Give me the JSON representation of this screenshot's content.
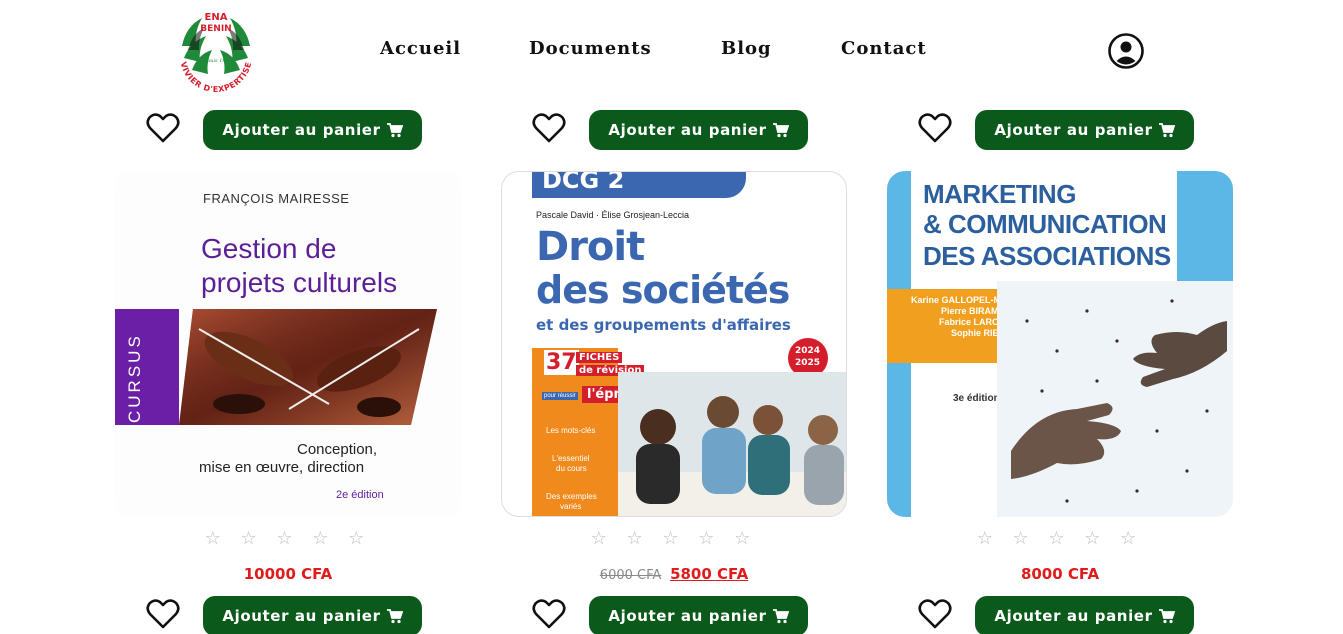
{
  "header": {
    "logo": {
      "line1": "ENA",
      "line2": "BENIN",
      "arc_text": "VIVIER D'EXPERTISE",
      "since": "Depuis 1994"
    },
    "nav": [
      {
        "label": "Accueil"
      },
      {
        "label": "Documents"
      },
      {
        "label": "Blog"
      },
      {
        "label": "Contact"
      }
    ],
    "account_icon": "user-circle-icon"
  },
  "top_row": [
    {
      "cart_label": "Ajouter au panier"
    },
    {
      "cart_label": "Ajouter au panier"
    },
    {
      "cart_label": "Ajouter au panier"
    }
  ],
  "products": [
    {
      "cover": {
        "author": "FRANÇOIS MAIRESSE",
        "title_line1": "Gestion de",
        "title_line2": "projets culturels",
        "series": "CURSUS",
        "subtitle_line1": "Conception,",
        "subtitle_line2": "mise en œuvre, direction",
        "edition": "2e édition"
      },
      "rating": "☆ ☆ ☆ ☆ ☆",
      "old_price": "",
      "price": "10000 CFA",
      "cart_label": "Ajouter au panier"
    },
    {
      "cover": {
        "series": "DCG 2",
        "authors": "Pascale David · Élise Grosjean-Leccia",
        "title_line1": "Droit",
        "title_line2": "des sociétés",
        "title_line3": "et des groupements d'affaires",
        "badge_num": "37",
        "badge_line1": "FICHES",
        "badge_line2": "de révision",
        "pour_reussir": "pour réussir",
        "epreuve": "l'épreuve",
        "year_line1": "2024",
        "year_line2": "2025",
        "bullet1_line1": "Les mots-clés",
        "bullet2_line1": "L'essentiel",
        "bullet2_line2": "du cours",
        "bullet3_line1": "Des exemples",
        "bullet3_line2": "variés"
      },
      "rating": "☆ ☆ ☆ ☆ ☆",
      "old_price": "6000 CFA",
      "price": "5800 CFA",
      "cart_label": "Ajouter au panier"
    },
    {
      "cover": {
        "title_line1": "MARKETING",
        "title_line2": "& COMMUNICATION",
        "title_line3": "DES ASSOCIATIONS",
        "author1": "Karine GALLOPEL-MORVAN",
        "author2": "Pierre BIRAMBEAU",
        "author3": "Fabrice LARCENEUX",
        "author4": "Sophie RIEUNIER",
        "edition": "3e édition"
      },
      "rating": "☆ ☆ ☆ ☆ ☆",
      "old_price": "",
      "price": "8000 CFA",
      "cart_label": "Ajouter au panier"
    }
  ],
  "colors": {
    "button_green": "#0b5a1b",
    "price_red": "#e01b1b",
    "cursus_purple": "#6b1fa6",
    "dcg_blue": "#3a67b0",
    "dcg_orange": "#f08a1c",
    "marketing_blue": "#5bb8e6"
  }
}
